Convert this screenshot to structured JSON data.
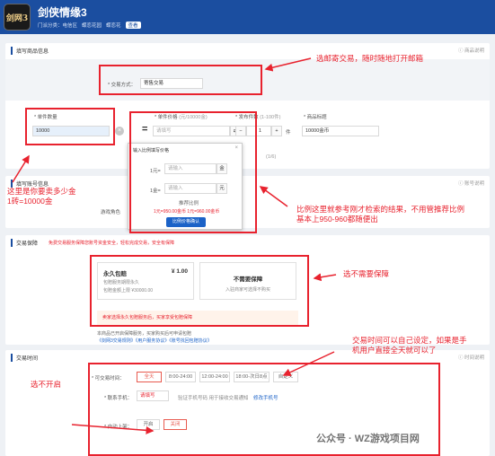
{
  "header": {
    "logo_text": "剑网3",
    "game_title": "剑侠情缘3",
    "crumbs": [
      "门派分类：电信区",
      "蝶恋花园",
      "蝶恋花"
    ],
    "crumb_tag": "查看"
  },
  "goods": {
    "title": "填写商品信息",
    "help": "商品说明",
    "trade_mode_label": "* 交易方式：",
    "trade_mode_value": "寄售交易",
    "unit_qty_label": "* 单件数量",
    "unit_qty_value": "10000",
    "unit_price_label": "* 单件价格",
    "unit_price_hint": "(元/10000金)",
    "unit_price_value": "请填写",
    "pieces_label": "* 发布件数",
    "pieces_hint": "(1-100件)",
    "pieces_value": "1",
    "pieces_unit": "件",
    "goods_title_label": "* 商品标题",
    "goods_title_value": "10000金币",
    "count_hint": "(1/6)"
  },
  "popup": {
    "title": "输入比例填写价格",
    "row1_label": "1元=",
    "row1_value": "请输入",
    "row1_unit": "金",
    "row2_label": "1金=",
    "row2_value": "请输入",
    "row2_unit": "元",
    "ratio_label": "推荐比例",
    "ratio_values": "1元=950.00金币    1元=960.00金币",
    "confirm": "比例价格确认"
  },
  "account": {
    "title": "填写账号信息",
    "help": "账号说明",
    "game_role_label": "游戏角色"
  },
  "protect": {
    "title": "交易保障",
    "subtitle": "免费交易服务保障您账号资金安全，轻松完成交易，安全有保障",
    "opt1_title": "永久包赔",
    "opt1_price": "¥ 1.00",
    "opt1_line1": "包赔服务期限永久",
    "opt1_line2": "包赔金额上限  ¥30000.00",
    "opt2_title": "不需要保障",
    "opt2_desc": "入驻商家可选择不购买",
    "note": "卖家选择永久包赔服务后，买家享受包赔保障",
    "footer1": "本商品已开启保障服务，买家购买后可申请包赔",
    "footer2": "《剑网3交易规则》《用户服务协议》《账号找回包赔协议》"
  },
  "trade_time": {
    "title": "交易时间",
    "help": "时间说明",
    "row_label": "* 可交易时间：",
    "options": [
      "全天",
      "8:00-24:00",
      "12:00-24:00",
      "18:00-次日8点",
      "自定义"
    ],
    "phone_label": "* 联系手机：",
    "phone_value": "请填写",
    "phone_note": "验证手机号码  用于接收交易通知",
    "phone_link": "修改手机号",
    "auto_label": "* 自动上架：",
    "auto_opts": [
      "开启",
      "关闭"
    ]
  },
  "annotations": {
    "a1": "选邮寄交易，随时随地打开邮箱",
    "a2_line1": "这里是你要卖多少金",
    "a2_line2": "1砖=10000金",
    "a3_line1": "比例这里就参考刚才检索的结果，不用管推荐比例",
    "a3_line2": "基本上950-960都随便出",
    "a4": "选不需要保障",
    "a5_line1": "交易时间可以自己设定，如果是手",
    "a5_line2": "机用户直接全天就可以了",
    "a6": "选不开启"
  },
  "watermark": "公众号 · WZ游戏项目网"
}
